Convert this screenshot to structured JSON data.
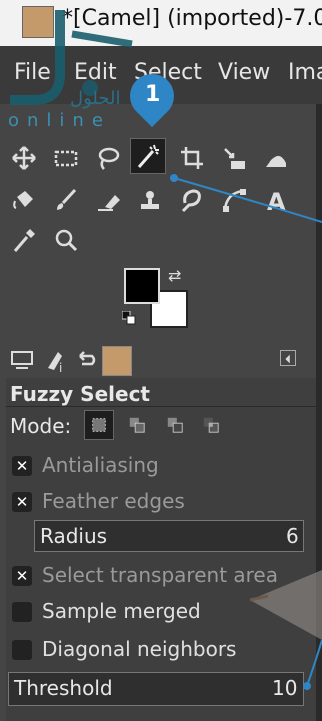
{
  "window": {
    "title": "*[Camel] (imported)-7.0"
  },
  "menu": [
    "File",
    "Edit",
    "Select",
    "View",
    "Ima"
  ],
  "watermark": {
    "arabic": "الحلول",
    "latin": "online"
  },
  "badge": "1",
  "options": {
    "title": "Fuzzy Select",
    "mode_label": "Mode:",
    "antialiasing": "Antialiasing",
    "feather": "Feather edges",
    "radius_label": "Radius",
    "radius_value": "6",
    "select_transparent": "Select transparent area",
    "sample_merged": "Sample merged",
    "diagonal": "Diagonal neighbors",
    "threshold_label": "Threshold",
    "threshold_value": "10"
  },
  "colors": {
    "accent": "#2f86c6",
    "panel": "#3f3f3f",
    "toolbox": "#454545"
  }
}
